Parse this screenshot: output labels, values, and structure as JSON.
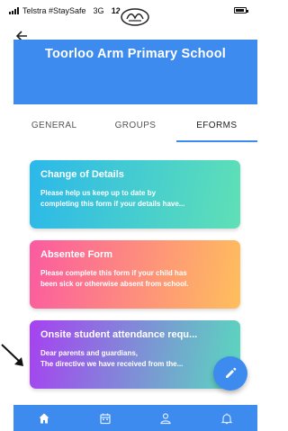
{
  "status_bar": {
    "carrier": "Telstra #StaySafe",
    "network": "3G",
    "time": "12:11 pm"
  },
  "header": {
    "back_icon": "back-arrow-icon",
    "logo_icon": "school-crest-logo",
    "banner_title": "Toorloo Arm Primary School"
  },
  "tabs": [
    {
      "label": "GENERAL",
      "active": false
    },
    {
      "label": "GROUPS",
      "active": false
    },
    {
      "label": "EFORMS",
      "active": true
    }
  ],
  "forms": [
    {
      "title": "Change of Details",
      "description_lines": [
        "Please help us keep up to date by",
        "completing this form if your details have..."
      ],
      "gradient": [
        "#2bb8ea",
        "#5fe0b6"
      ]
    },
    {
      "title": "Absentee Form",
      "description_lines": [
        "Please complete this form if your child has",
        "been sick or otherwise absent from school."
      ],
      "gradient": [
        "#fb5aa0",
        "#ffbf5c"
      ]
    },
    {
      "title": "Onsite student attendance requ...",
      "description_lines": [
        "Dear parents and guardians,",
        "The directive we have received from the..."
      ],
      "gradient": [
        "#a641f1",
        "#59d9bd"
      ]
    }
  ],
  "fab": {
    "icon": "edit-pencil-icon"
  },
  "bottom_nav": [
    {
      "icon": "home-icon",
      "active": true
    },
    {
      "icon": "calendar-icon",
      "active": false
    },
    {
      "icon": "person-icon",
      "active": false
    },
    {
      "icon": "bell-icon",
      "active": false
    }
  ],
  "colors": {
    "accent": "#3d8bef"
  }
}
